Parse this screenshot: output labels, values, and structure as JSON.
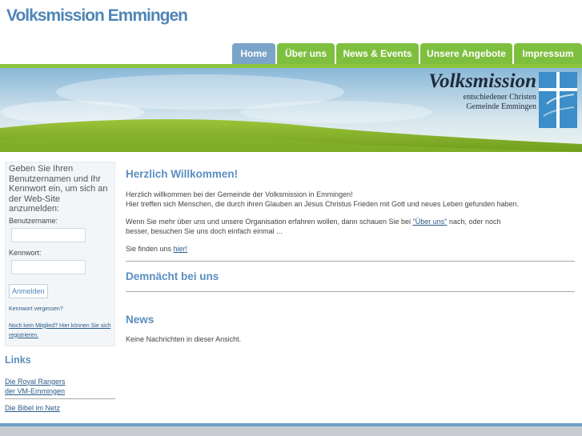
{
  "header": {
    "site_title": "Volksmission Emmingen"
  },
  "nav": {
    "tabs": [
      {
        "label": "Home",
        "active": true
      },
      {
        "label": "Über uns",
        "active": false
      },
      {
        "label": "News & Events",
        "active": false
      },
      {
        "label": "Unsere Angebote",
        "active": false
      },
      {
        "label": "Impressum",
        "active": false
      }
    ]
  },
  "banner": {
    "brand_main": "Volksmission",
    "brand_line1": "entschiedener Christen",
    "brand_line2": "Gemeinde Emmingen"
  },
  "login": {
    "intro": "Geben Sie Ihren Benutzernamen und Ihr Kennwort ein, um sich an der Web-Site anzumelden:",
    "username_label": "Benutzername:",
    "username_value": "",
    "password_label": "Kennwort:",
    "password_value": "",
    "submit_label": "Anmelden",
    "forgot_link": "Kennwort vergessen?",
    "register_link": "Noch kein Mitglied? Hier können Sie sich registrieren."
  },
  "links": {
    "heading": "Links",
    "items": [
      "Die Royal Rangers der VM-Emmingen",
      "Die Bibel im Netz"
    ]
  },
  "main": {
    "welcome_heading": "Herzlich Willkommen!",
    "welcome_p1a": "Herzlich willkommen bei der Gemeinde der Volksmission in Emmingen!",
    "welcome_p1b": "Hier treffen sich Menschen, die durch ihren Glauben an Jesus Christus Frieden mit Gott und neues Leben gefunden haben.",
    "welcome_p2_before": "Wenn Sie mehr über uns und unsere Organisation erfahren wollen, dann schauen Sie bei ",
    "welcome_p2_link": "\"Über uns\"",
    "welcome_p2_after": " nach, oder noch besser, besuchen Sie uns doch einfach einmal ...",
    "welcome_p3_before": "Sie finden uns ",
    "welcome_p3_link": "hier!",
    "upcoming_heading": "Demnächt bei uns",
    "news_heading": "News",
    "news_empty": "Keine Nachrichten in dieser Ansicht."
  },
  "colors": {
    "accent_blue": "#5a8fc0",
    "nav_green": "#7fbf3f",
    "nav_active": "#7aa4c8"
  }
}
